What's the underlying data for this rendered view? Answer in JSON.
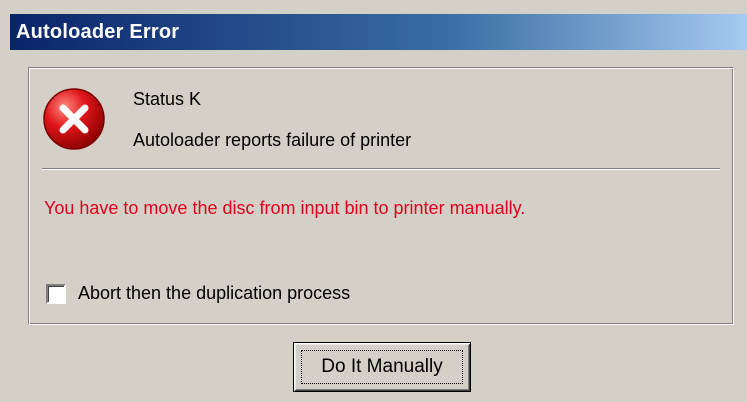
{
  "window": {
    "title": "Autoloader Error"
  },
  "message": {
    "icon": "error-icon",
    "status_title": "Status K",
    "status_description": "Autoloader reports failure of printer",
    "instruction": "You have to move the disc from input bin to printer manually.",
    "instruction_color": "#e0001c"
  },
  "abort_checkbox": {
    "label": "Abort then the duplication process",
    "checked": false
  },
  "buttons": {
    "do_it_manually": "Do It Manually"
  },
  "colors": {
    "title_bar_start": "#0a246a",
    "title_bar_end": "#a6caf0",
    "dialog_face": "#d4d0c8"
  }
}
